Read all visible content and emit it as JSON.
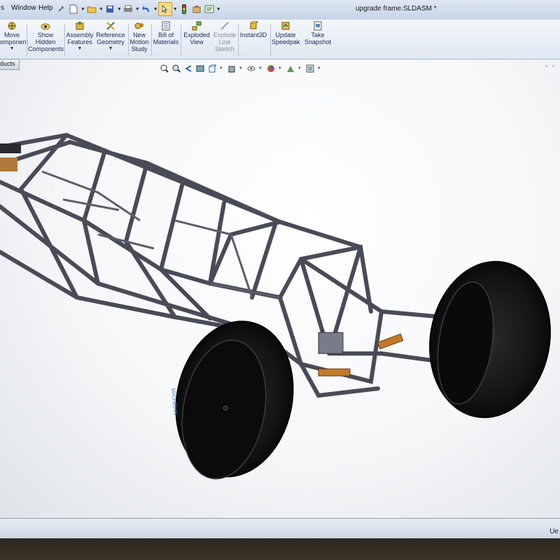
{
  "menu": {
    "partial_left": "s",
    "window": "Window",
    "help": "Help"
  },
  "window": {
    "title": "upgrade frame.SLDASM *"
  },
  "ribbon": {
    "move_component": [
      "Move",
      "omponent"
    ],
    "show_hidden": [
      "Show",
      "Hidden",
      "Components"
    ],
    "assembly_features": [
      "Assembly",
      "Features"
    ],
    "reference_geometry": [
      "Reference",
      "Geometry"
    ],
    "new_motion_study": [
      "New",
      "Motion",
      "Study"
    ],
    "bill_of_materials": [
      "Bill of",
      "Materials"
    ],
    "exploded_view": [
      "Exploded",
      "View"
    ],
    "explode_line_sketch": [
      "Explode",
      "Line",
      "Sketch"
    ],
    "instant3d": [
      "Instant3D"
    ],
    "update_speedpak": [
      "Update",
      "Speedpak"
    ],
    "take_snapshot": [
      "Take",
      "Snapshot"
    ]
  },
  "tabs": {
    "products_partial": "ducts"
  },
  "statusbar": {
    "partial": "Ue"
  },
  "tire": {
    "brand": "MICHELIN"
  },
  "icons": [
    "move-component-icon",
    "show-hidden-icon",
    "assembly-features-icon",
    "reference-geometry-icon",
    "motion-study-icon",
    "bill-of-materials-icon",
    "exploded-view-icon",
    "explode-line-sketch-icon",
    "instant3d-icon",
    "update-speedpak-icon",
    "take-snapshot-icon"
  ],
  "colors": {
    "frame": "#4a4b58",
    "tire": "#0e0e10",
    "spring": "#c27a2a",
    "ribbon_text": "#1c2a55"
  }
}
